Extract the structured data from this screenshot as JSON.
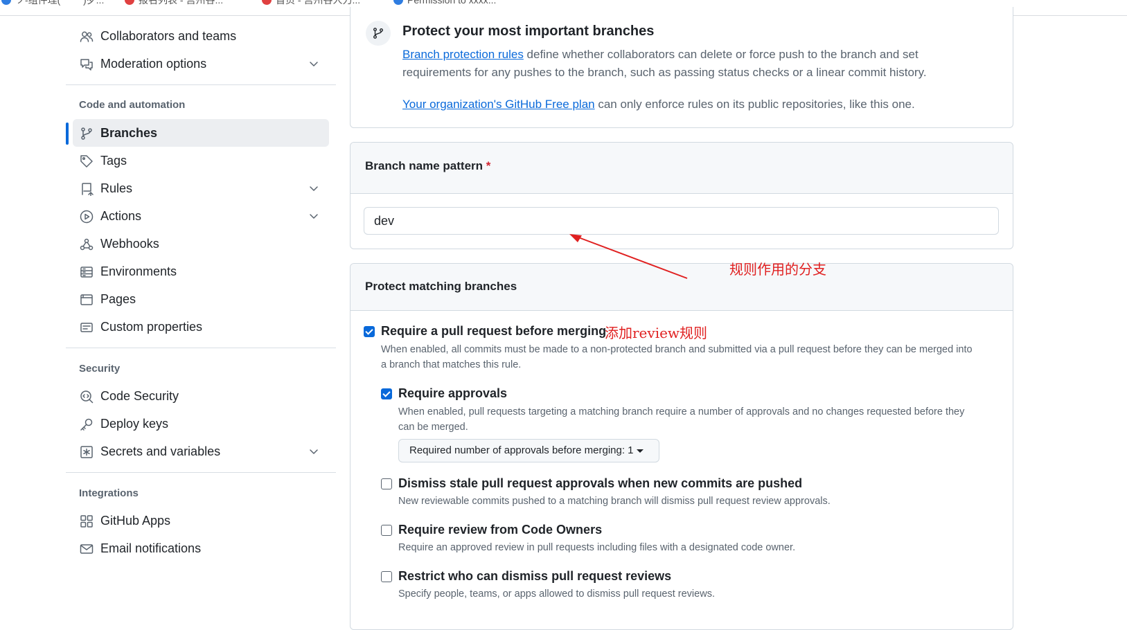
{
  "bookmarks": [
    "ソ-组件理(",
    ")歹...",
    "报名列表 - 宫州谷...",
    "首页 - 宫州谷人力...",
    "Permission to xxxx..."
  ],
  "sidebar": {
    "top_items": [
      {
        "label": "Collaborators and teams",
        "icon": "people-icon",
        "has_chevron": false
      },
      {
        "label": "Moderation options",
        "icon": "comment-discussion-icon",
        "has_chevron": true
      }
    ],
    "sections": [
      {
        "heading": "Code and automation",
        "items": [
          {
            "label": "Branches",
            "icon": "git-branch-icon",
            "active": true
          },
          {
            "label": "Tags",
            "icon": "tag-icon"
          },
          {
            "label": "Rules",
            "icon": "repo-push-icon",
            "has_chevron": true
          },
          {
            "label": "Actions",
            "icon": "play-icon",
            "has_chevron": true
          },
          {
            "label": "Webhooks",
            "icon": "webhook-icon"
          },
          {
            "label": "Environments",
            "icon": "server-icon"
          },
          {
            "label": "Pages",
            "icon": "browser-icon"
          },
          {
            "label": "Custom properties",
            "icon": "note-icon"
          }
        ]
      },
      {
        "heading": "Security",
        "items": [
          {
            "label": "Code Security",
            "icon": "codescan-icon"
          },
          {
            "label": "Deploy keys",
            "icon": "key-icon"
          },
          {
            "label": "Secrets and variables",
            "icon": "key-asterisk-icon",
            "has_chevron": true
          }
        ]
      },
      {
        "heading": "Integrations",
        "items": [
          {
            "label": "GitHub Apps",
            "icon": "apps-icon"
          },
          {
            "label": "Email notifications",
            "icon": "mail-icon"
          }
        ]
      }
    ]
  },
  "info": {
    "title": "Protect your most important branches",
    "link1": "Branch protection rules",
    "text1": " define whether collaborators can delete or force push to the branch and set",
    "text2": "requirements for any pushes to the branch, such as passing status checks or a linear commit history.",
    "link2": "Your organization's GitHub Free plan",
    "text3": " can only enforce rules on its public repositories, like this one."
  },
  "pattern": {
    "label": "Branch name pattern",
    "required_mark": "*",
    "value": "dev"
  },
  "protect": {
    "heading": "Protect matching branches",
    "options": [
      {
        "title": "Require a pull request before merging",
        "checked": true,
        "desc1": "When enabled, all commits must be made to a non-protected branch and submitted via a pull request before they can be merged into",
        "desc2": "a branch that matches this rule."
      },
      {
        "title": "Require approvals",
        "checked": true,
        "desc1": "When enabled, pull requests targeting a matching branch require a number of approvals and no changes requested before they",
        "desc2": "can be merged."
      },
      {
        "title": "Dismiss stale pull request approvals when new commits are pushed",
        "checked": false,
        "desc1": "New reviewable commits pushed to a matching branch will dismiss pull request review approvals."
      },
      {
        "title": "Require review from Code Owners",
        "checked": false,
        "desc1": "Require an approved review in pull requests including files with a designated code owner."
      },
      {
        "title": "Restrict who can dismiss pull request reviews",
        "checked": false,
        "desc1": "Specify people, teams, or apps allowed to dismiss pull request reviews."
      }
    ],
    "approvals_select": "Required number of approvals before merging: 1"
  },
  "annotations": {
    "branch_note": "规则作用的分支",
    "review_note": "添加review规则",
    "color": "#e02020"
  },
  "colors": {
    "accent": "#0969da",
    "muted": "#59636e"
  }
}
